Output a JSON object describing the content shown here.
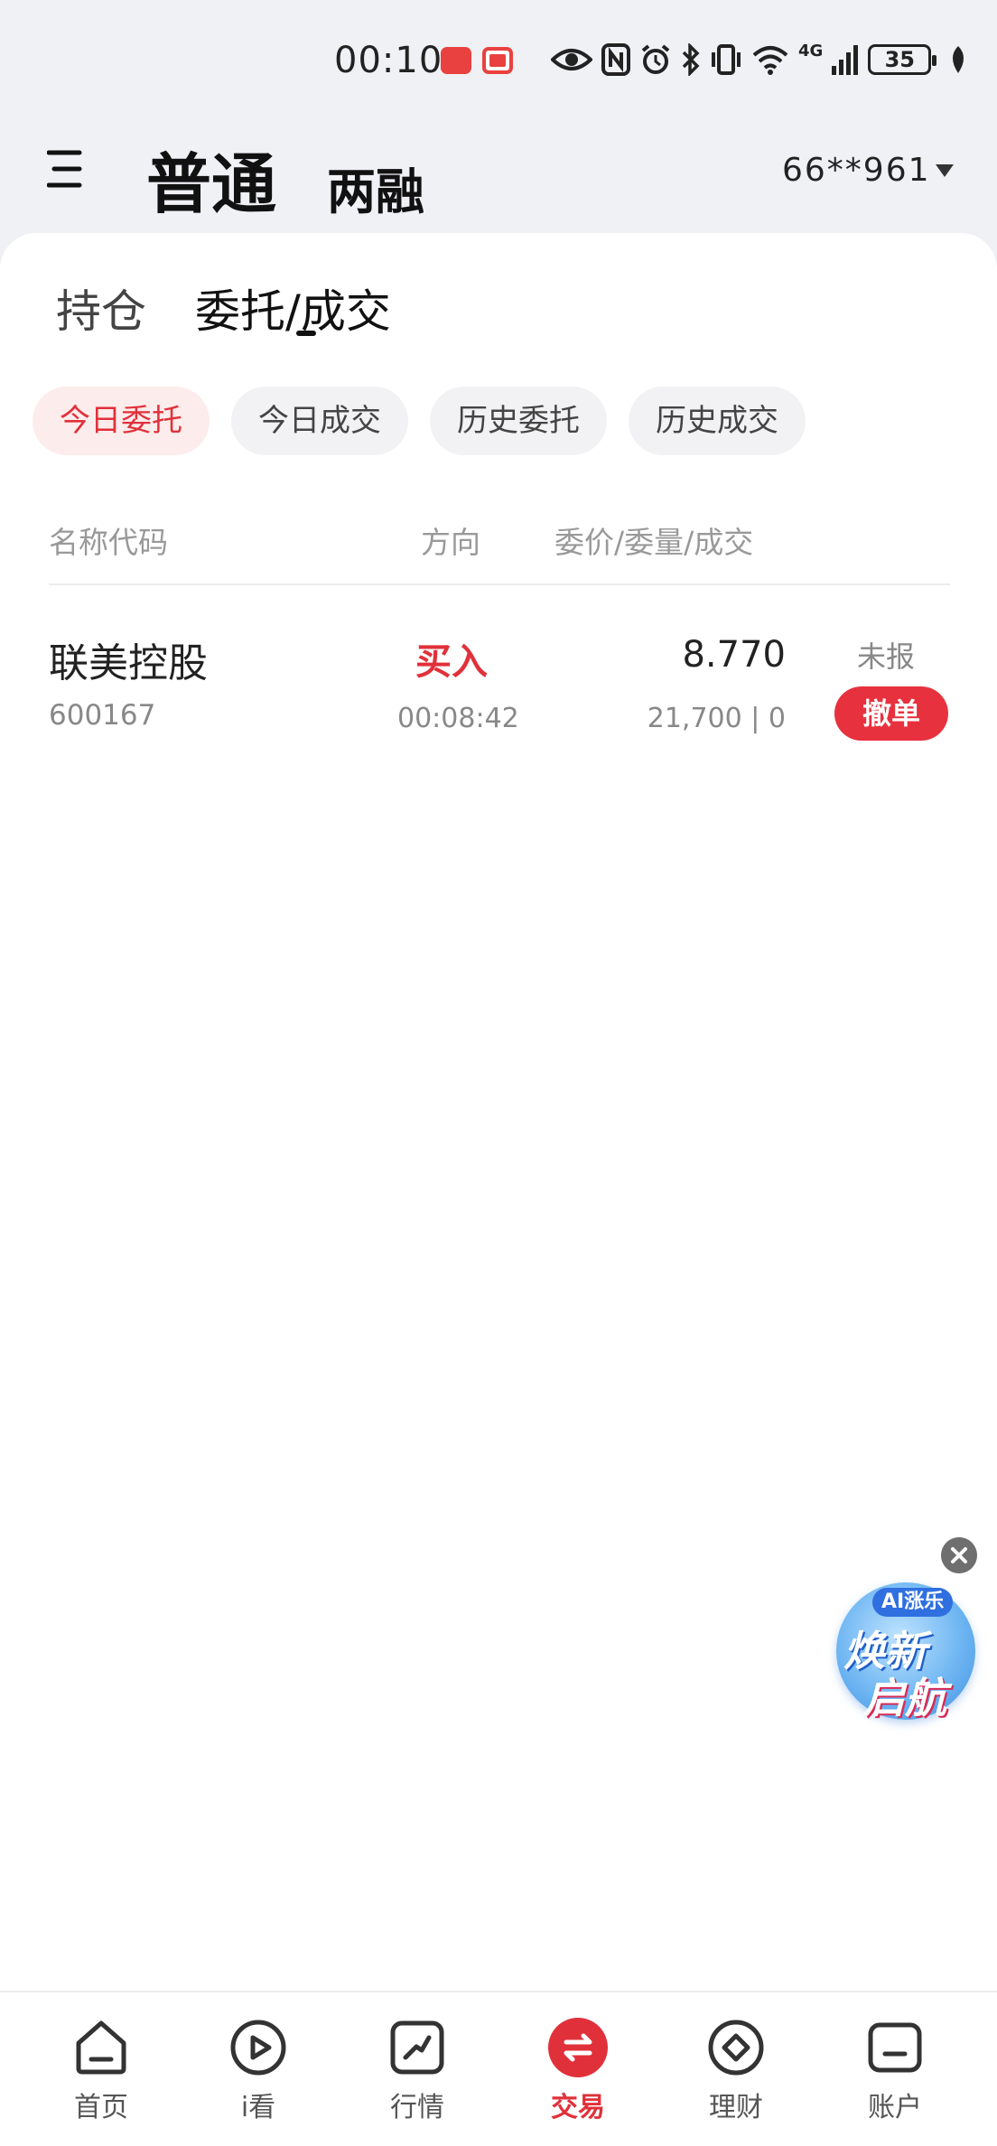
{
  "status_bar": {
    "time": "00:10",
    "network": "4G",
    "battery": "35"
  },
  "top_nav": {
    "tab_main": "普通",
    "tab_sub": "两融",
    "account": "66**961"
  },
  "sub_tabs": {
    "holdings": "持仓",
    "orders": "委托/成交"
  },
  "filters": [
    "今日委托",
    "今日成交",
    "历史委托",
    "历史成交"
  ],
  "columns": {
    "name": "名称代码",
    "direction": "方向",
    "price_qty": "委价/委量/成交"
  },
  "orders": [
    {
      "name": "联美控股",
      "code": "600167",
      "direction": "买入",
      "time": "00:08:42",
      "price": "8.770",
      "qty_filled": "21,700 | 0",
      "status": "未报",
      "action": "撤单"
    }
  ],
  "ad": {
    "tag": "AI涨乐",
    "line1": "焕新",
    "line2": "启航"
  },
  "bottom_nav": [
    "首页",
    "i看",
    "行情",
    "交易",
    "理财",
    "账户"
  ],
  "colors": {
    "accent_red": "#e0313a",
    "page_bg": "#f0f1f5"
  }
}
